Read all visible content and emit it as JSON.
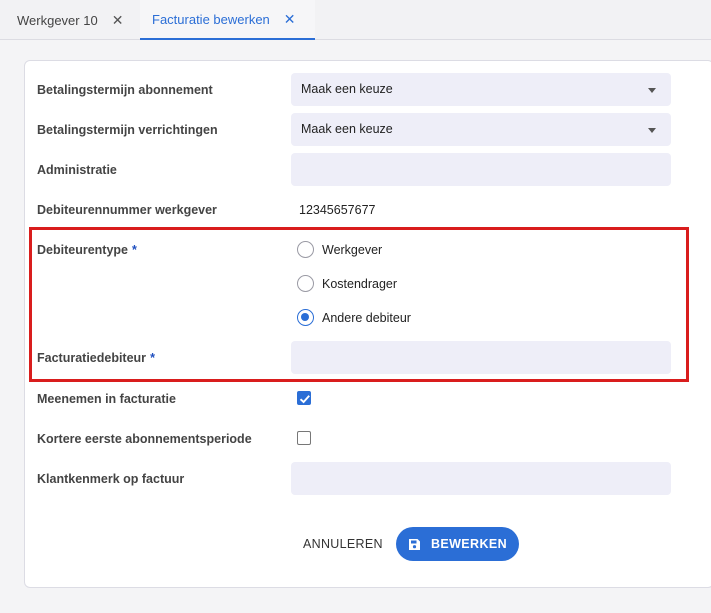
{
  "tabs": [
    {
      "label": "Werkgever 10",
      "close": "✕"
    },
    {
      "label": "Facturatie bewerken",
      "close": "✕"
    }
  ],
  "form": {
    "betalingstermijn_abonnement": {
      "label": "Betalingstermijn abonnement",
      "value": "Maak een keuze"
    },
    "betalingstermijn_verrichtingen": {
      "label": "Betalingstermijn verrichtingen",
      "value": "Maak een keuze"
    },
    "administratie": {
      "label": "Administratie",
      "value": ""
    },
    "debiteurennummer": {
      "label": "Debiteurennummer werkgever",
      "value": "12345657677"
    },
    "debiteurentype": {
      "label": "Debiteurentype",
      "required": "*",
      "options": [
        "Werkgever",
        "Kostendrager",
        "Andere debiteur"
      ],
      "selected": "Andere debiteur"
    },
    "facturatiedebiteur": {
      "label": "Facturatiedebiteur",
      "required": "*",
      "value": ""
    },
    "meenemen": {
      "label": "Meenemen in facturatie",
      "checked": true
    },
    "kortere": {
      "label": "Kortere eerste abonnementsperiode",
      "checked": false
    },
    "klantkenmerk": {
      "label": "Klantkenmerk op factuur",
      "value": ""
    }
  },
  "actions": {
    "cancel_label": "ANNULEREN",
    "save_label": "BEWERKEN"
  },
  "colors": {
    "accent": "#2b6ed6",
    "highlight": "#d91d1d",
    "field_bg": "#eeeef8"
  }
}
